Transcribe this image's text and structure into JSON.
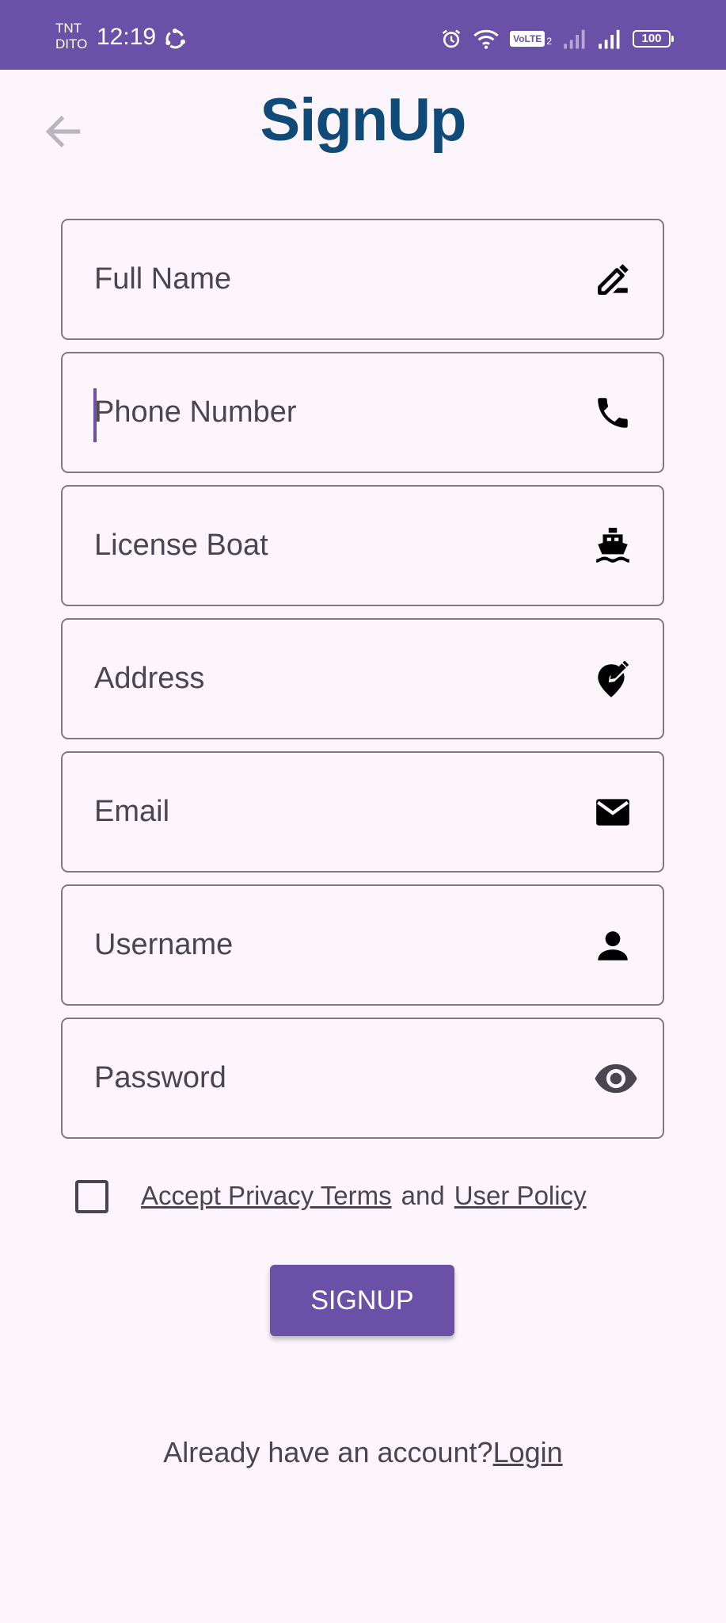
{
  "status_bar": {
    "carrier_line1": "TNT",
    "carrier_line2": "DITO",
    "time": "12:19",
    "volte": "VoLTE",
    "sim_index": "2",
    "battery": "100"
  },
  "header": {
    "title": "SignUp"
  },
  "form": {
    "fields": [
      {
        "label": "Full Name",
        "icon": "edit-pen-icon"
      },
      {
        "label": "Phone Number",
        "icon": "phone-icon"
      },
      {
        "label": "License Boat",
        "icon": "boat-icon"
      },
      {
        "label": "Address",
        "icon": "edit-location-icon"
      },
      {
        "label": "Email",
        "icon": "email-icon"
      },
      {
        "label": "Username",
        "icon": "person-icon"
      },
      {
        "label": "Password",
        "icon": "eye-icon"
      }
    ],
    "terms": {
      "privacy_link": "Accept Privacy Terms",
      "and": "and",
      "policy_link": "User Policy",
      "checked": false
    },
    "submit_label": "SIGNUP"
  },
  "footer": {
    "prompt": "Already have an account?",
    "login_link": "Login"
  },
  "colors": {
    "primary": "#6a50a7",
    "title": "#104a78",
    "background": "#fcf6fc",
    "text": "#4a4650"
  }
}
